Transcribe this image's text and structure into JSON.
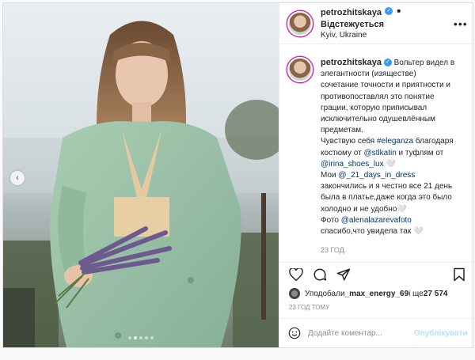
{
  "header": {
    "username": "petrozhitskaya",
    "separator": "•",
    "follow_label": "Відстежується",
    "location": "Kyiv, Ukraine",
    "more_icon": "more-horizontal-icon"
  },
  "caption": {
    "username": "petrozhitskaya",
    "line1": "Вольтер видел в элегантности (изяществе) сочетание точности и приятности и противопоставлял это понятие грации, которую приписывал исключительно одушевлённым предметам.",
    "line2a": "Чувствую себя ",
    "tag1": "#eleganza",
    "line2b": " благодаря костюму от ",
    "tag2": "@stlkatin",
    "line2c": " и туфлям от ",
    "tag3": "@irina_shoes_lux",
    "line2d": " 🤍",
    "line3a": "Мои ",
    "tag4": "@_21_days_in_dress",
    "line3b": " закончились и я честно все 21 день была в платье,даже когда это было холодно и не удобно🤍",
    "line4a": "Фото ",
    "tag5": "@alenalazarevafoto",
    "line4b": "спасибо,что увидела так 🤍",
    "time": "23 год."
  },
  "likes": {
    "prefix": "Уподобали ",
    "user": "_max_energy_69",
    "middle": " і ще ",
    "count": "27 574"
  },
  "posted_ago": "23 ГОД ТОМУ",
  "comment": {
    "placeholder": "Додайте коментар...",
    "publish_label": "Опублікувати"
  },
  "colors": {
    "accent_link": "#00376b",
    "verified": "#3897f0",
    "publish_disabled": "#b2dffc"
  }
}
